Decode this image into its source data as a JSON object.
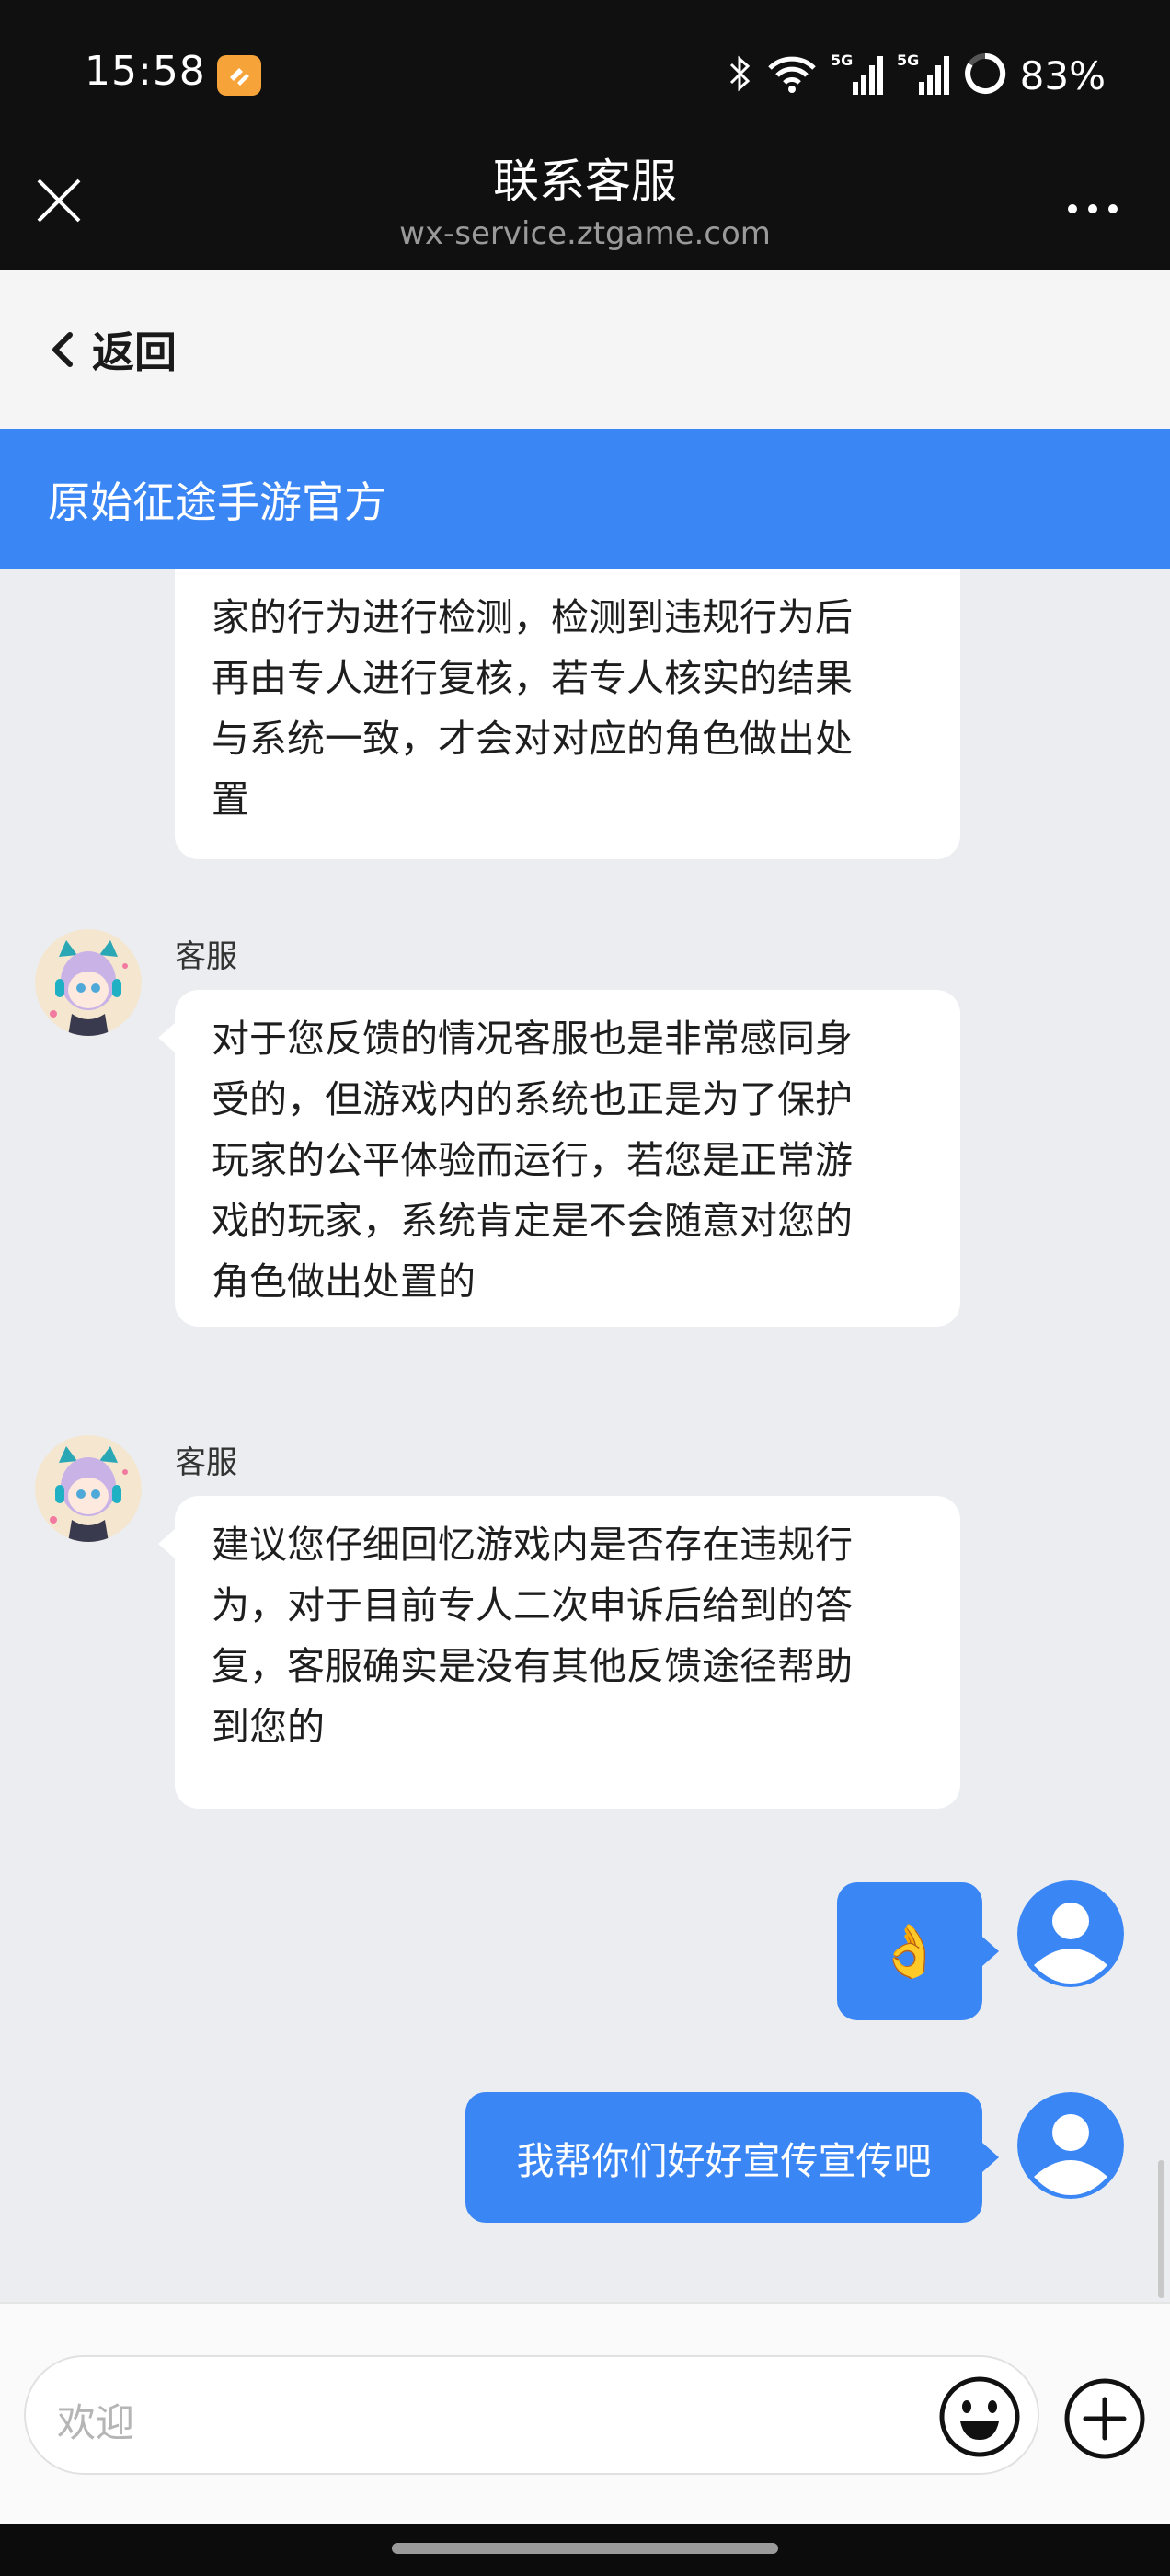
{
  "status_bar": {
    "time": "15:58",
    "battery": "83%",
    "network_1": "5G",
    "network_2": "5G"
  },
  "title_bar": {
    "title": "联系客服",
    "url": "wx-service.ztgame.com"
  },
  "back_bar": {
    "label": "返回"
  },
  "header": {
    "shop_name": "原始征途手游官方"
  },
  "messages": [
    {
      "side": "agent",
      "lines": [
        "家的行为进行检测，检测到违规行为后",
        "再由专人进行复核，若专人核实的结果",
        "与系统一致，才会对对应的角色做出处",
        "置"
      ]
    },
    {
      "side": "agent",
      "sender": "客服",
      "lines": [
        "对于您反馈的情况客服也是非常感同身",
        "受的，但游戏内的系统也正是为了保护",
        "玩家的公平体验而运行，若您是正常游",
        "戏的玩家，系统肯定是不会随意对您的",
        "角色做出处置的"
      ]
    },
    {
      "side": "agent",
      "sender": "客服",
      "lines": [
        "建议您仔细回忆游戏内是否存在违规行",
        "为，对于目前专人二次申诉后给到的答",
        "复，客服确实是没有其他反馈途径帮助",
        "到您的"
      ]
    },
    {
      "side": "user",
      "text": "👌"
    },
    {
      "side": "user",
      "text": "我帮你们好好宣传宣传吧"
    }
  ],
  "input": {
    "placeholder": "欢迎"
  },
  "colors": {
    "accent": "#3b86f5",
    "chat_bg": "#ebedf0",
    "status_bg": "#101010"
  },
  "icons": [
    "close-icon",
    "more-icon",
    "back-chevron-icon",
    "emoji-icon",
    "plus-icon",
    "user-avatar-icon",
    "agent-avatar"
  ]
}
